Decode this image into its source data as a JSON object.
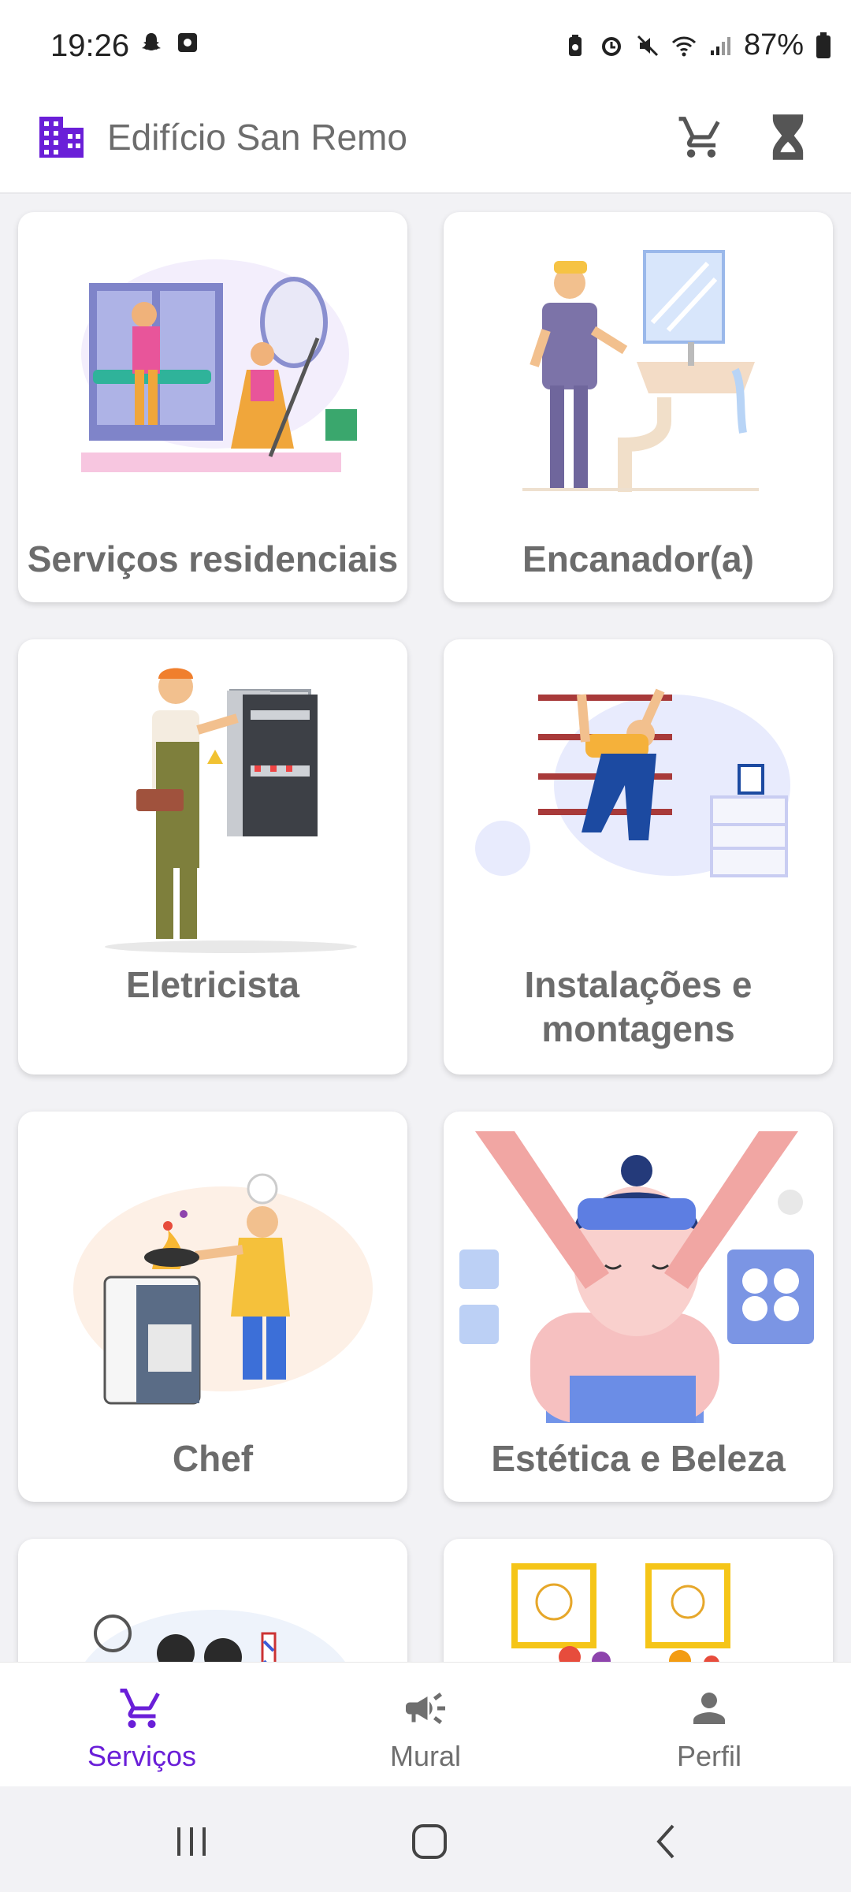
{
  "status_bar": {
    "time": "19:26",
    "battery": "87%"
  },
  "app_bar": {
    "title": "Edifício San Remo",
    "brand_color": "#6a1fd8"
  },
  "services": [
    {
      "label": "Serviços residenciais",
      "illustration": "cleaning-illustration"
    },
    {
      "label": "Encanador(a)",
      "illustration": "plumber-illustration"
    },
    {
      "label": "Eletricista",
      "illustration": "electrician-illustration"
    },
    {
      "label": "Instalações e montagens",
      "illustration": "installation-illustration"
    },
    {
      "label": "Chef",
      "illustration": "chef-illustration"
    },
    {
      "label": "Estética e Beleza",
      "illustration": "beauty-illustration"
    },
    {
      "label": "",
      "illustration": "barber-illustration"
    },
    {
      "label": "",
      "illustration": "kids-art-illustration"
    }
  ],
  "bottom_nav": {
    "items": [
      {
        "label": "Serviços",
        "icon": "cart-icon",
        "active": true
      },
      {
        "label": "Mural",
        "icon": "megaphone-icon",
        "active": false
      },
      {
        "label": "Perfil",
        "icon": "person-icon",
        "active": false
      }
    ],
    "active_color": "#6a1fd8",
    "inactive_color": "#6f6f6f"
  }
}
